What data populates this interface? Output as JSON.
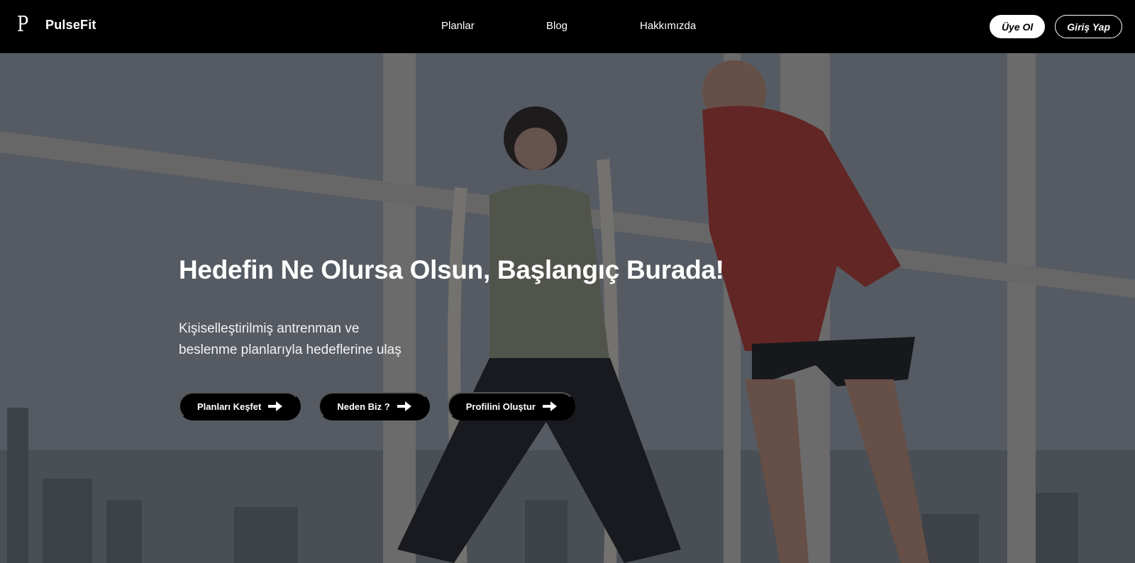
{
  "brand": {
    "logo_glyph": "P",
    "name": "PulseFit"
  },
  "nav": {
    "links": [
      "Planlar",
      "Blog",
      "Hakkımızda"
    ]
  },
  "auth": {
    "signup_label": "Üye Ol",
    "login_label": "Giriş Yap"
  },
  "hero": {
    "title": "Hedefin Ne Olursa Olsun, Başlangıç Burada!",
    "subtitle_line1": "Kişiselleştirilmiş antrenman ve",
    "subtitle_line2": "beslenme planlarıyla hedeflerine ulaş",
    "buttons": [
      {
        "label": "Planları Keşfet",
        "icon": "arrow-right-icon"
      },
      {
        "label": "Neden Biz ?",
        "icon": "arrow-right-icon"
      },
      {
        "label": "Profilini Oluştur",
        "icon": "arrow-right-icon"
      }
    ],
    "background_image": "gym-training-photo"
  },
  "colors": {
    "navbar_bg": "#000000",
    "text": "#ffffff",
    "cta_bg": "#000000",
    "signup_bg": "#ffffff"
  }
}
